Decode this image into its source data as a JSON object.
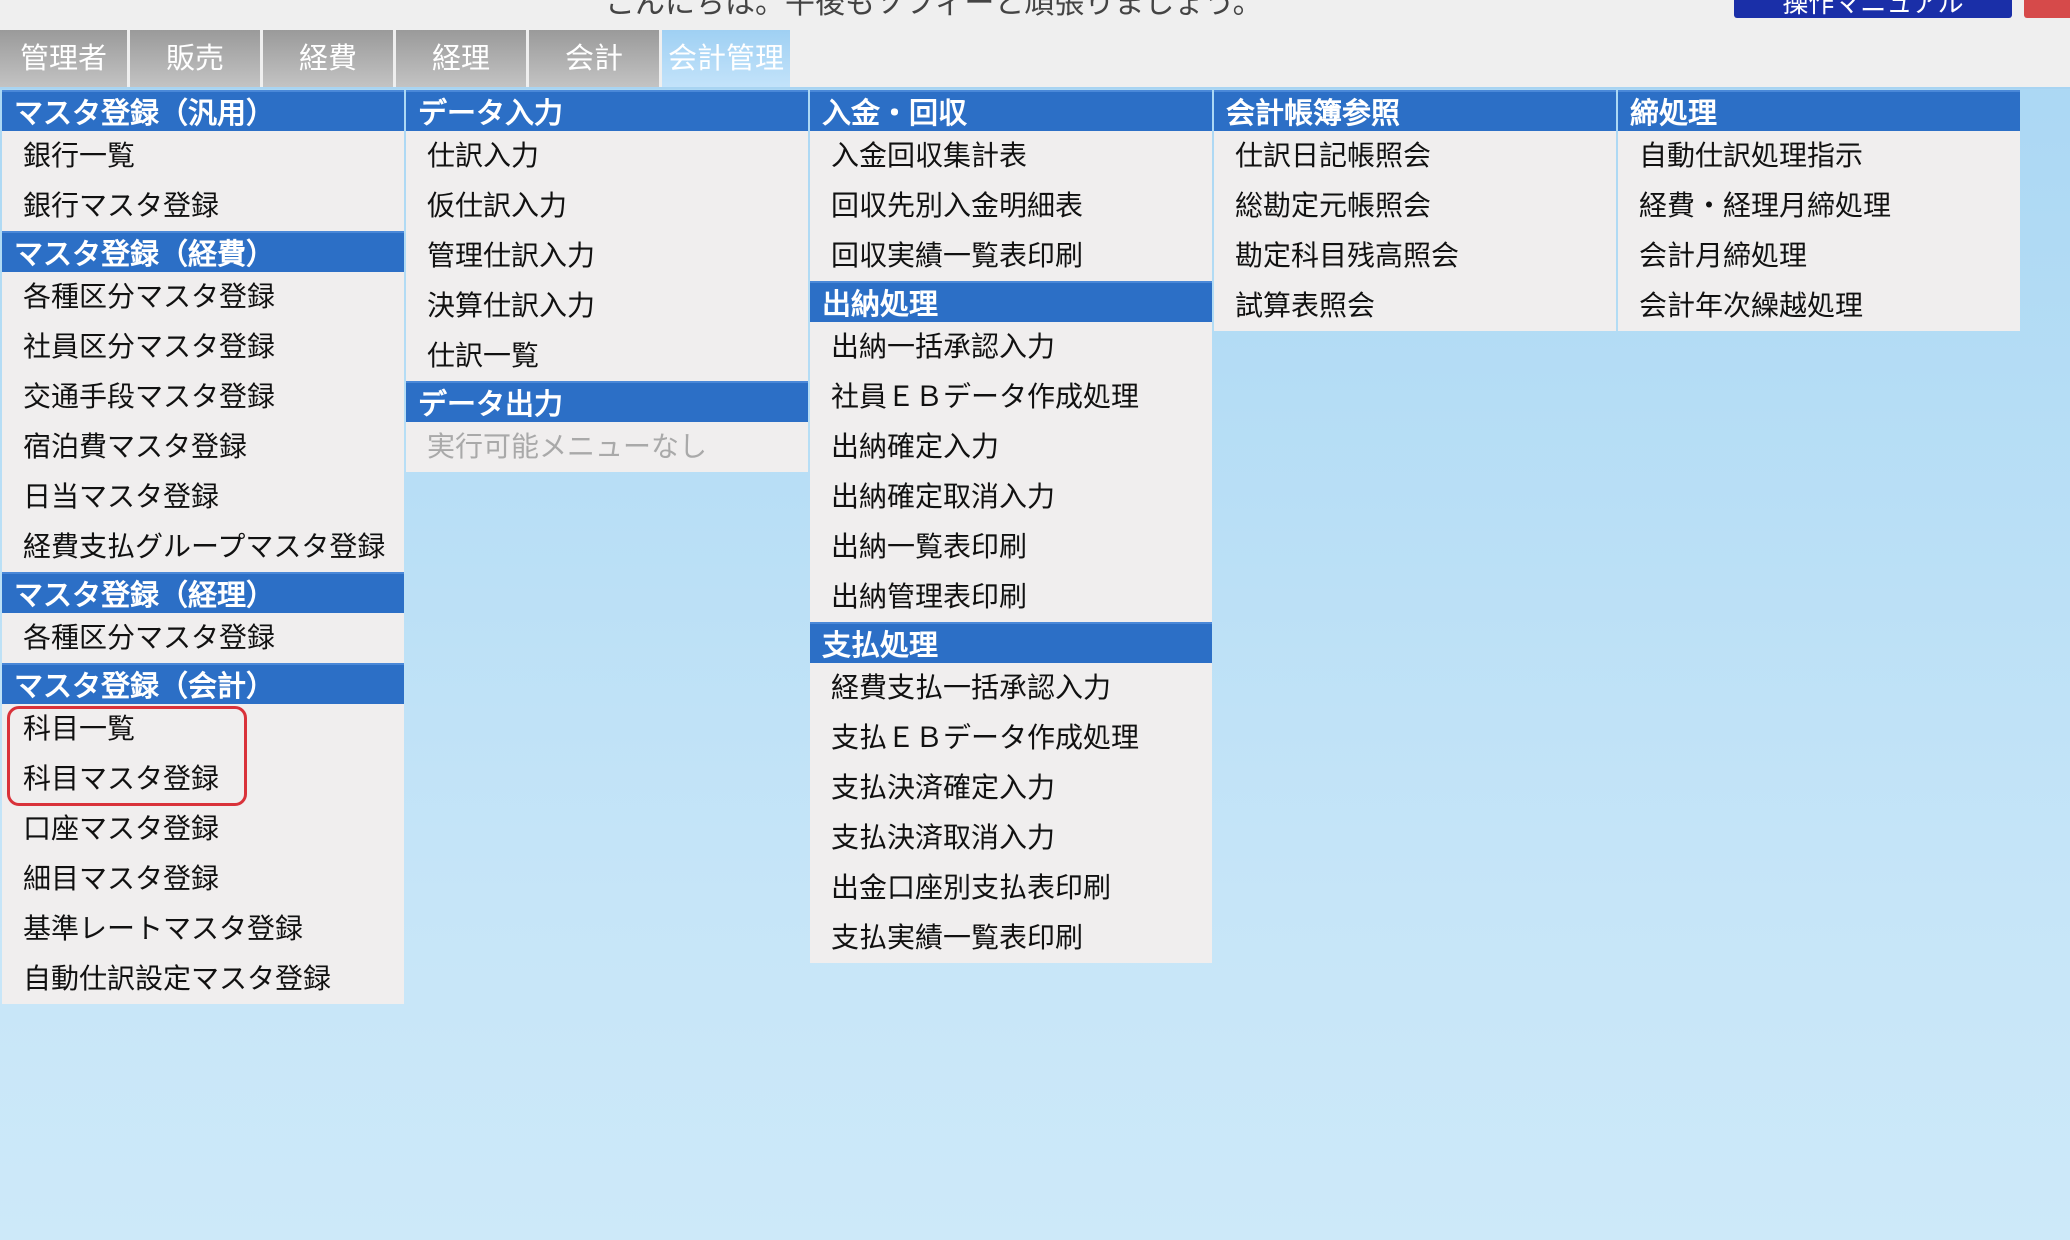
{
  "header": {
    "greeting": "こんにちは。午後もソフィーと頑張りましょう。",
    "manual_label": "操作マニュアル"
  },
  "tabs": [
    {
      "label": "管理者"
    },
    {
      "label": "販売"
    },
    {
      "label": "経費"
    },
    {
      "label": "経理"
    },
    {
      "label": "会計"
    },
    {
      "label": "会計管理",
      "active": true
    }
  ],
  "columns": [
    {
      "sections": [
        {
          "title": "マスタ登録（汎用）",
          "items": [
            "銀行一覧",
            "銀行マスタ登録"
          ]
        },
        {
          "title": "マスタ登録（経費）",
          "items": [
            "各種区分マスタ登録",
            "社員区分マスタ登録",
            "交通手段マスタ登録",
            "宿泊費マスタ登録",
            "日当マスタ登録",
            "経費支払グループマスタ登録"
          ]
        },
        {
          "title": "マスタ登録（経理）",
          "items": [
            "各種区分マスタ登録"
          ]
        },
        {
          "title": "マスタ登録（会計）",
          "items": [
            "科目一覧",
            "科目マスタ登録",
            "口座マスタ登録",
            "細目マスタ登録",
            "基準レートマスタ登録",
            "自動仕訳設定マスタ登録"
          ]
        }
      ]
    },
    {
      "sections": [
        {
          "title": "データ入力",
          "items": [
            "仕訳入力",
            "仮仕訳入力",
            "管理仕訳入力",
            "決算仕訳入力",
            "仕訳一覧"
          ]
        },
        {
          "title": "データ出力",
          "disabled_items": [
            "実行可能メニューなし"
          ]
        }
      ]
    },
    {
      "sections": [
        {
          "title": "入金・回収",
          "items": [
            "入金回収集計表",
            "回収先別入金明細表",
            "回収実績一覧表印刷"
          ]
        },
        {
          "title": "出納処理",
          "items": [
            "出納一括承認入力",
            "社員ＥＢデータ作成処理",
            "出納確定入力",
            "出納確定取消入力",
            "出納一覧表印刷",
            "出納管理表印刷"
          ]
        },
        {
          "title": "支払処理",
          "items": [
            "経費支払一括承認入力",
            "支払ＥＢデータ作成処理",
            "支払決済確定入力",
            "支払決済取消入力",
            "出金口座別支払表印刷",
            "支払実績一覧表印刷"
          ]
        }
      ]
    },
    {
      "sections": [
        {
          "title": "会計帳簿参照",
          "items": [
            "仕訳日記帳照会",
            "総勘定元帳照会",
            "勘定科目残高照会",
            "試算表照会"
          ]
        }
      ]
    },
    {
      "sections": [
        {
          "title": "締処理",
          "items": [
            "自動仕訳処理指示",
            "経費・経理月締処理",
            "会計月締処理",
            "会計年次繰越処理"
          ]
        }
      ]
    }
  ],
  "colors": {
    "section_header": "#2c6fc6",
    "active_tab": "#b3dbf7",
    "highlight": "#d9323a"
  }
}
